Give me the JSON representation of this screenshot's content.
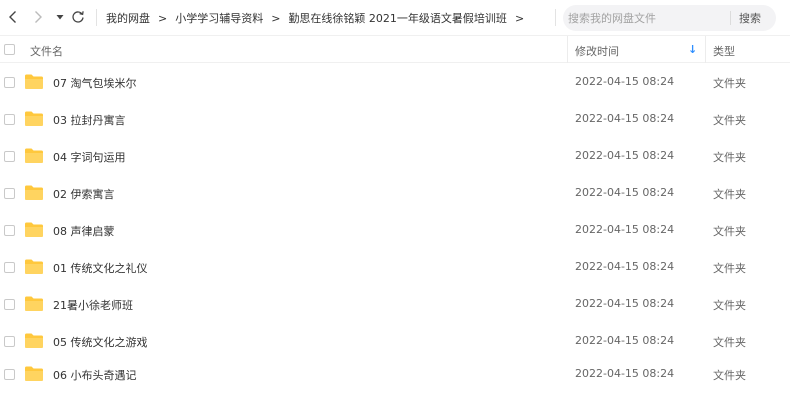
{
  "toolbar": {
    "breadcrumb": [
      "我的网盘",
      "小学学习辅导资料",
      "勤思在线徐铭颖 2021一年级语文暑假培训班"
    ],
    "breadcrumb_separator": ">",
    "search_placeholder": "搜索我的网盘文件",
    "search_button": "搜索"
  },
  "columns": {
    "name": "文件名",
    "modified": "修改时间",
    "type": "类型",
    "sort_indicator": "↓"
  },
  "files": [
    {
      "name": "07 淘气包埃米尔",
      "modified": "2022-04-15 08:24",
      "type": "文件夹"
    },
    {
      "name": "03 拉封丹寓言",
      "modified": "2022-04-15 08:24",
      "type": "文件夹"
    },
    {
      "name": "04 字词句运用",
      "modified": "2022-04-15 08:24",
      "type": "文件夹"
    },
    {
      "name": "02 伊索寓言",
      "modified": "2022-04-15 08:24",
      "type": "文件夹"
    },
    {
      "name": "08 声律启蒙",
      "modified": "2022-04-15 08:24",
      "type": "文件夹"
    },
    {
      "name": "01 传统文化之礼仪",
      "modified": "2022-04-15 08:24",
      "type": "文件夹"
    },
    {
      "name": "21暑小徐老师班",
      "modified": "2022-04-15 08:24",
      "type": "文件夹"
    },
    {
      "name": "05 传统文化之游戏",
      "modified": "2022-04-15 08:24",
      "type": "文件夹"
    },
    {
      "name": "06 小布头奇遇记",
      "modified": "2022-04-15 08:24",
      "type": "文件夹"
    }
  ],
  "icons": {
    "back": "chevron-left-icon",
    "forward": "chevron-right-icon",
    "history": "caret-down-icon",
    "refresh": "refresh-icon",
    "folder": "folder-icon"
  },
  "colors": {
    "folder": "#ffc83d",
    "accent": "#2f8fff",
    "search_bg": "#f3f3f5"
  }
}
